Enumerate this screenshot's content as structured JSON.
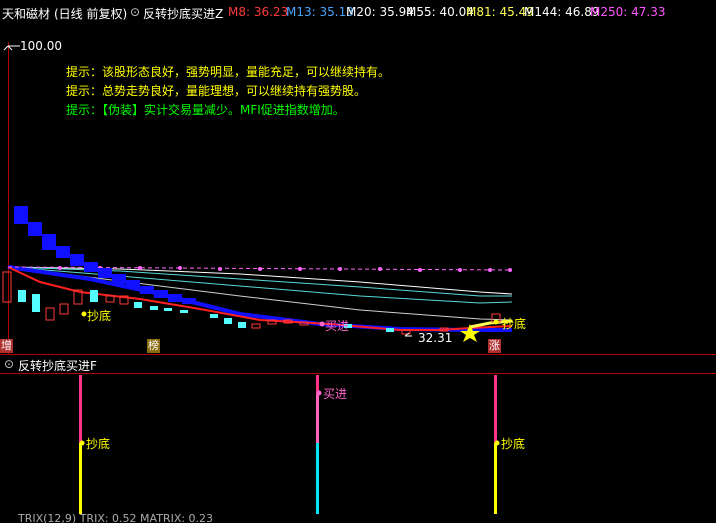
{
  "header": {
    "stock_name": "天和磁材",
    "period": "(日线 前复权)",
    "indicator": "反转抄底买进Z",
    "ma": [
      {
        "label": "M8: 36.23",
        "color": "#ff3b3b"
      },
      {
        "label": "M13: 35.13",
        "color": "#4aa3ff"
      },
      {
        "label": "M20: 35.94",
        "color": "#ffffff"
      },
      {
        "label": "M55: 40.04",
        "color": "#ffffff"
      },
      {
        "label": "M81: 45.49",
        "color": "#ffff55"
      },
      {
        "label": "M144: 46.89",
        "color": "#ffffff"
      },
      {
        "label": "M250: 47.33",
        "color": "#ff55ff"
      }
    ]
  },
  "main_chart": {
    "price_top_label": "100.00",
    "price_low_label": "32.31",
    "hints": [
      {
        "prefix": "提示：",
        "text": "该股形态良好，强势明显，量能充足，可以继续持有。",
        "color": "#ffff00"
      },
      {
        "prefix": "提示：",
        "text": "总势走势良好，量能理想，可以继续持有强势股。",
        "color": "#ffff00"
      },
      {
        "prefix": "提示：",
        "text": "【伪装】实计交易量减少。MFI促进指数增加。",
        "color": "#00ff00"
      }
    ],
    "tags": {
      "buy_dip_left": "抄底",
      "buy_in": "买进",
      "buy_dip_right": "抄底"
    },
    "badges": {
      "left": "增",
      "mid": "榜",
      "right": "涨"
    }
  },
  "sub_chart": {
    "title": "反转抄底买进F",
    "tags": {
      "buy_dip_left": "抄底",
      "buy_in": "买进",
      "buy_dip_right": "抄底"
    }
  },
  "footer": {
    "text": "TRIX(12,9)  TRIX: 0.52  MATRIX: 0.23"
  },
  "colors": {
    "background": "#000000",
    "up_candle": "#ff3b3b",
    "down_candle": "#54ffff",
    "blue_band": "#1010ff",
    "ma_red": "#ff2020",
    "panel_divider": "#b00000"
  }
}
